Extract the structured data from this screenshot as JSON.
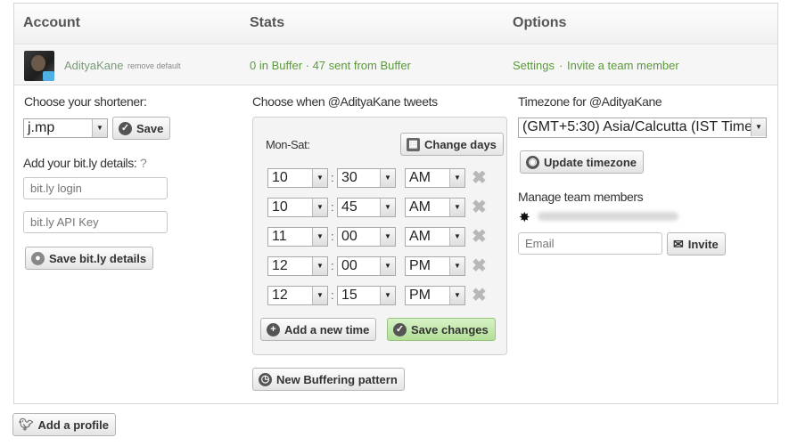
{
  "header": {
    "account": "Account",
    "stats": "Stats",
    "options": "Options"
  },
  "profile": {
    "username": "AdityaKane",
    "remove_default": "remove default",
    "stats_text": "0 in Buffer · 47 sent from Buffer",
    "settings": "Settings",
    "separator": "·",
    "invite": "Invite a team member"
  },
  "shortener": {
    "label": "Choose your shortener:",
    "value": "j.mp",
    "save": "Save",
    "bitly_label": "Add your bit.ly details:",
    "help": "?",
    "login_placeholder": "bit.ly login",
    "api_placeholder": "bit.ly API Key",
    "save_bitly": "Save bit.ly details"
  },
  "schedule": {
    "label": "Choose when @AdityaKane tweets",
    "days": "Mon-Sat:",
    "change_days": "Change days",
    "times": [
      {
        "hour": "10",
        "minute": "30",
        "ampm": "AM"
      },
      {
        "hour": "10",
        "minute": "45",
        "ampm": "AM"
      },
      {
        "hour": "11",
        "minute": "00",
        "ampm": "AM"
      },
      {
        "hour": "12",
        "minute": "00",
        "ampm": "PM"
      },
      {
        "hour": "12",
        "minute": "15",
        "ampm": "PM"
      }
    ],
    "add_time": "Add a new time",
    "save_changes": "Save changes",
    "new_pattern": "New Buffering pattern"
  },
  "options": {
    "timezone_label": "Timezone for @AdityaKane",
    "timezone_value": "(GMT+5:30) Asia/Calcutta (IST Time",
    "update_timezone": "Update timezone",
    "manage_label": "Manage team members",
    "email_placeholder": "Email",
    "invite": "Invite"
  },
  "footer": {
    "add_profile": "Add a profile"
  }
}
